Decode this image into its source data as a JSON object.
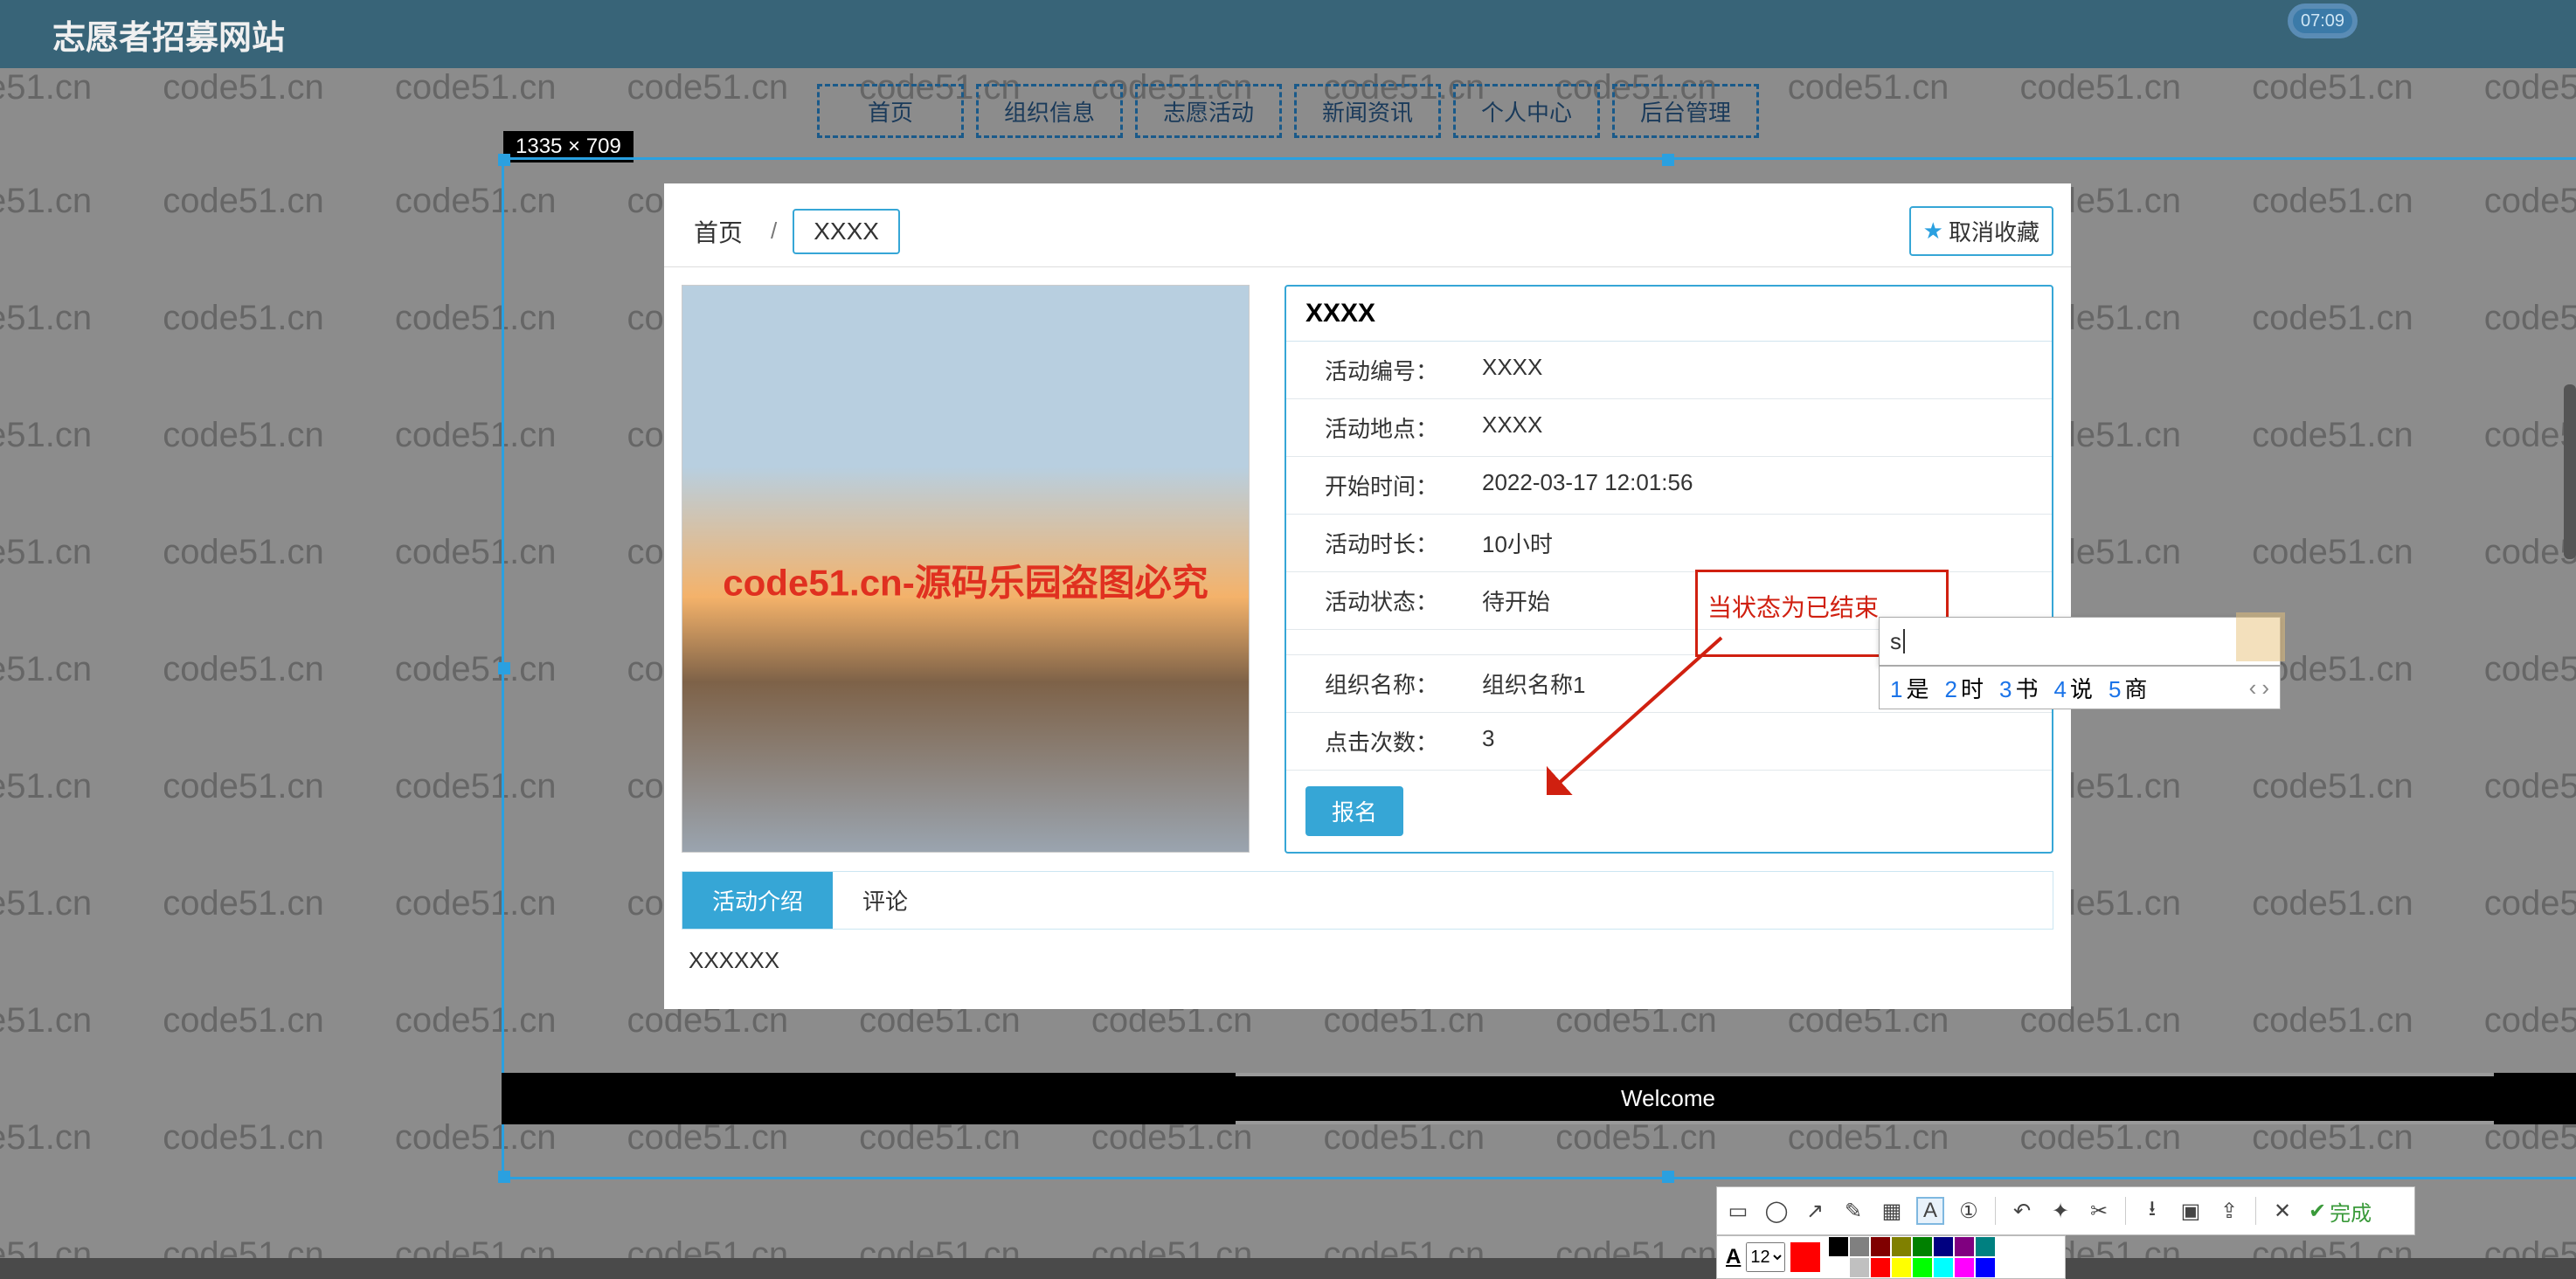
{
  "header": {
    "site_title": "志愿者招募网站",
    "clock": "07:09"
  },
  "watermark": "code51.cn",
  "nav": {
    "items": [
      "首页",
      "组织信息",
      "志愿活动",
      "新闻资讯",
      "个人中心",
      "后台管理"
    ]
  },
  "selection_size": "1335 × 709",
  "breadcrumb": {
    "home": "首页",
    "sep": "/",
    "current": "XXXX"
  },
  "fav_button": "取消收藏",
  "photo_overlay": "code51.cn-源码乐园盗图必究",
  "detail": {
    "title": "XXXX",
    "rows": [
      {
        "label": "活动编号：",
        "value": "XXXX"
      },
      {
        "label": "活动地点：",
        "value": "XXXX"
      },
      {
        "label": "开始时间：",
        "value": "2022-03-17 12:01:56"
      },
      {
        "label": "活动时长：",
        "value": "10小时"
      },
      {
        "label": "活动状态：",
        "value": "待开始"
      },
      {
        "label": "",
        "value": ""
      },
      {
        "label": "组织名称：",
        "value": "组织名称1"
      },
      {
        "label": "点击次数：",
        "value": "3"
      }
    ],
    "signup": "报名"
  },
  "tabs": {
    "active": "活动介绍",
    "other": "评论",
    "content": "XXXXXX"
  },
  "footer": "Welcome",
  "annotation": "当状态为已结束",
  "ime": {
    "typed": "s",
    "candidates": [
      {
        "n": "1",
        "t": "是"
      },
      {
        "n": "2",
        "t": "时"
      },
      {
        "n": "3",
        "t": "书"
      },
      {
        "n": "4",
        "t": "说"
      },
      {
        "n": "5",
        "t": "商"
      }
    ]
  },
  "shot_toolbar": {
    "done": "完成",
    "font_size": "12"
  },
  "palette": {
    "current": "#ff0000",
    "row1": [
      "#000000",
      "#808080",
      "#800000",
      "#808000",
      "#008000",
      "#000080",
      "#800080",
      "#008080"
    ],
    "row2": [
      "#ffffff",
      "#c0c0c0",
      "#ff0000",
      "#ffff00",
      "#00ff00",
      "#00ffff",
      "#ff00ff",
      "#0000ff"
    ]
  }
}
